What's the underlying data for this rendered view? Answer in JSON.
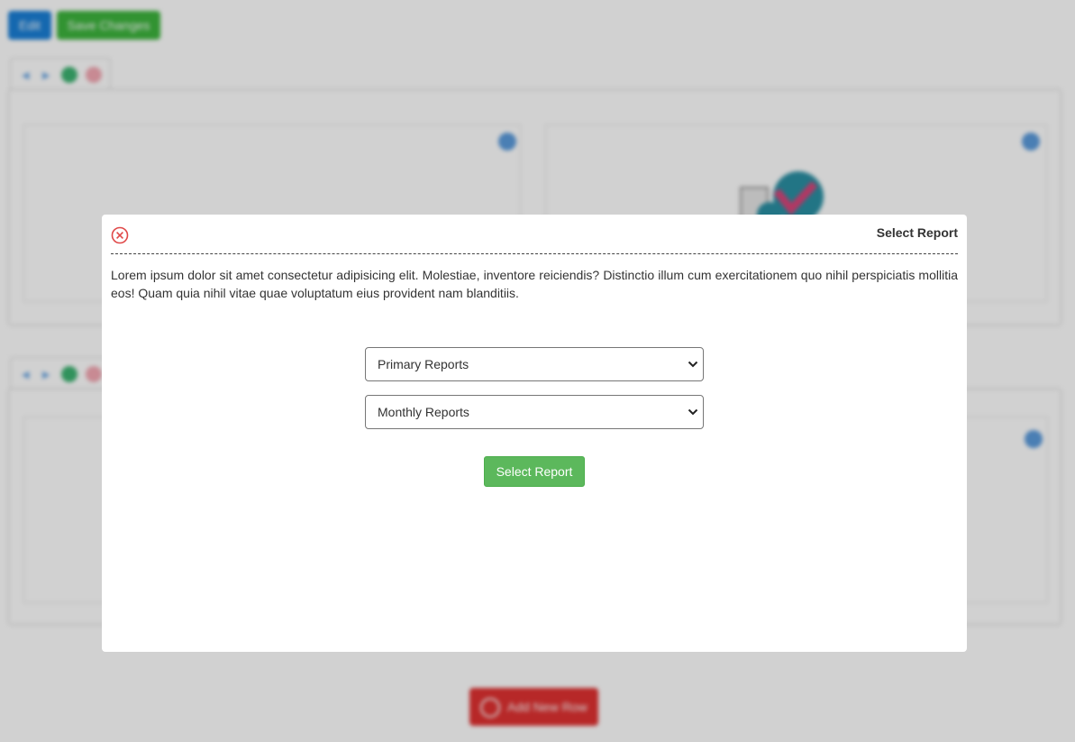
{
  "background": {
    "edit_label": "Edit",
    "save_label": "Save Changes",
    "add_row_label": "Add New Row",
    "colors": {
      "edit": "#1a7fd6",
      "save": "#3db43d",
      "add_row": "#e03131"
    }
  },
  "modal": {
    "title": "Select Report",
    "description": "Lorem ipsum dolor sit amet consectetur adipisicing elit. Molestiae, inventore reiciendis? Distinctio illum cum exercitationem quo nihil perspiciatis mollitia eos! Quam quia nihil vitae quae voluptatum eius provident nam blanditiis.",
    "report_category": {
      "selected": "Primary Reports"
    },
    "report_period": {
      "selected": "Monthly Reports"
    },
    "submit_label": "Select Report",
    "colors": {
      "submit": "#5cb85c",
      "close": "#e04848"
    }
  }
}
